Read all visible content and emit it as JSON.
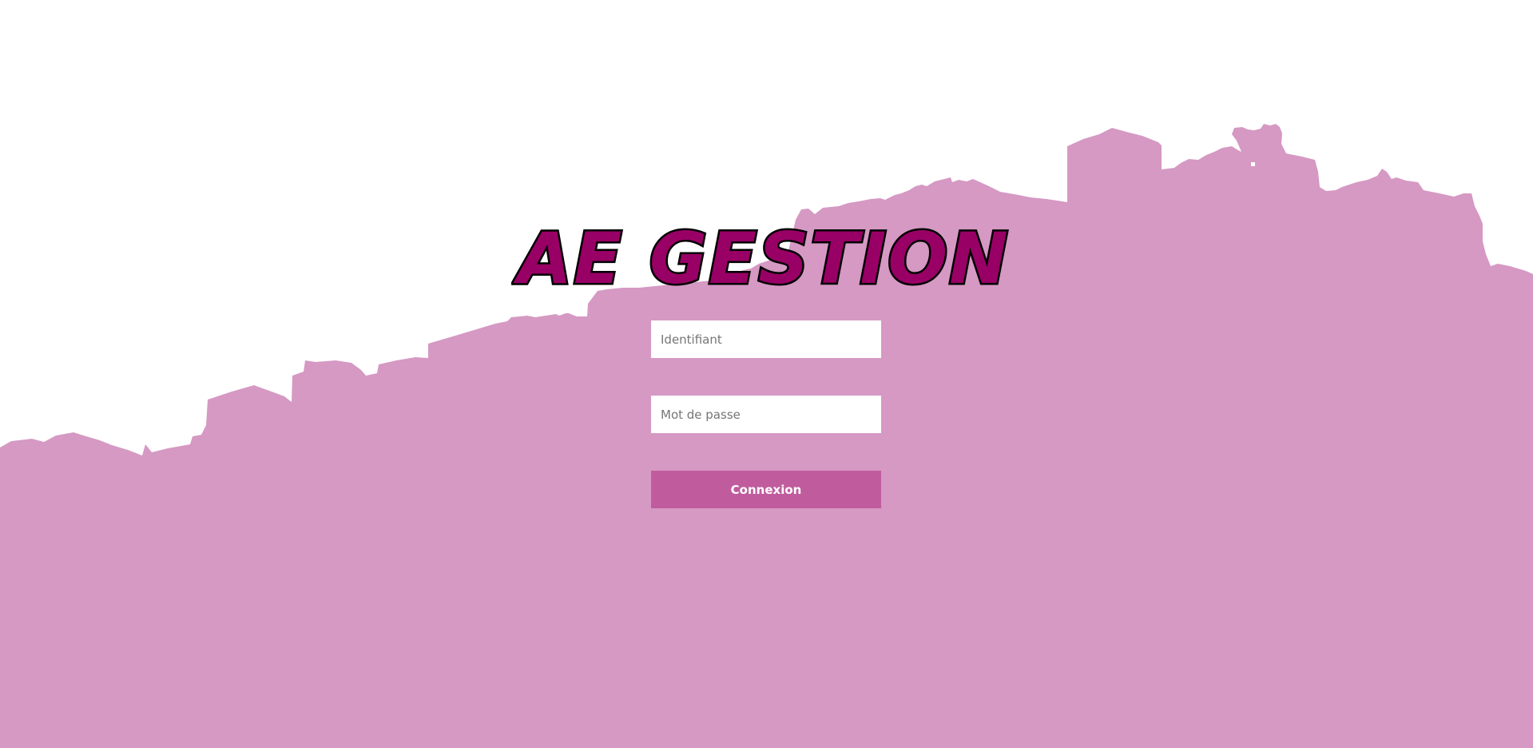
{
  "app": {
    "logo_text": "AE GESTION"
  },
  "login_form": {
    "username_placeholder": "Identifiant",
    "password_placeholder": "Mot de passe",
    "submit_label": "Connexion"
  },
  "colors": {
    "background": "#ffffff",
    "skyline": "#d599c3",
    "logo_fill": "#990066",
    "logo_outline": "#000000",
    "button": "#c05c9e",
    "button_text": "#ffffff",
    "input_background": "#ffffff"
  }
}
